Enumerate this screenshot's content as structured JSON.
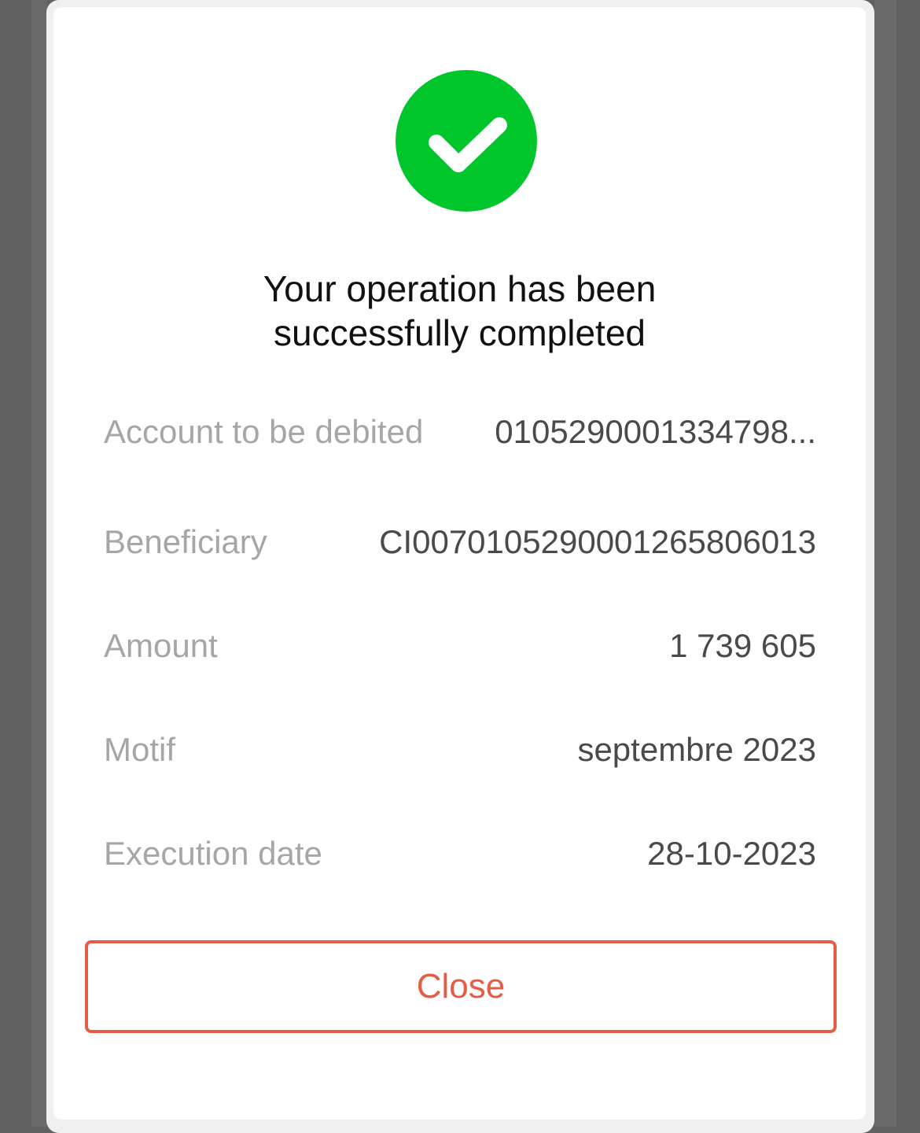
{
  "dialog": {
    "status_icon": "check-circle-icon",
    "title_line1": "Your operation has been",
    "title_line2": "successfully completed",
    "accent_color": "#00c62b",
    "details": [
      {
        "label": "Account to be debited",
        "value": "0105290001334798..."
      },
      {
        "label": "Beneficiary",
        "value": "CI0070105290001265806013"
      },
      {
        "label": "Amount",
        "value": "1 739 605"
      },
      {
        "label": "Motif",
        "value": "septembre 2023"
      },
      {
        "label": "Execution date",
        "value": "28-10-2023"
      }
    ],
    "close_label": "Close",
    "close_color": "#e65d45"
  }
}
